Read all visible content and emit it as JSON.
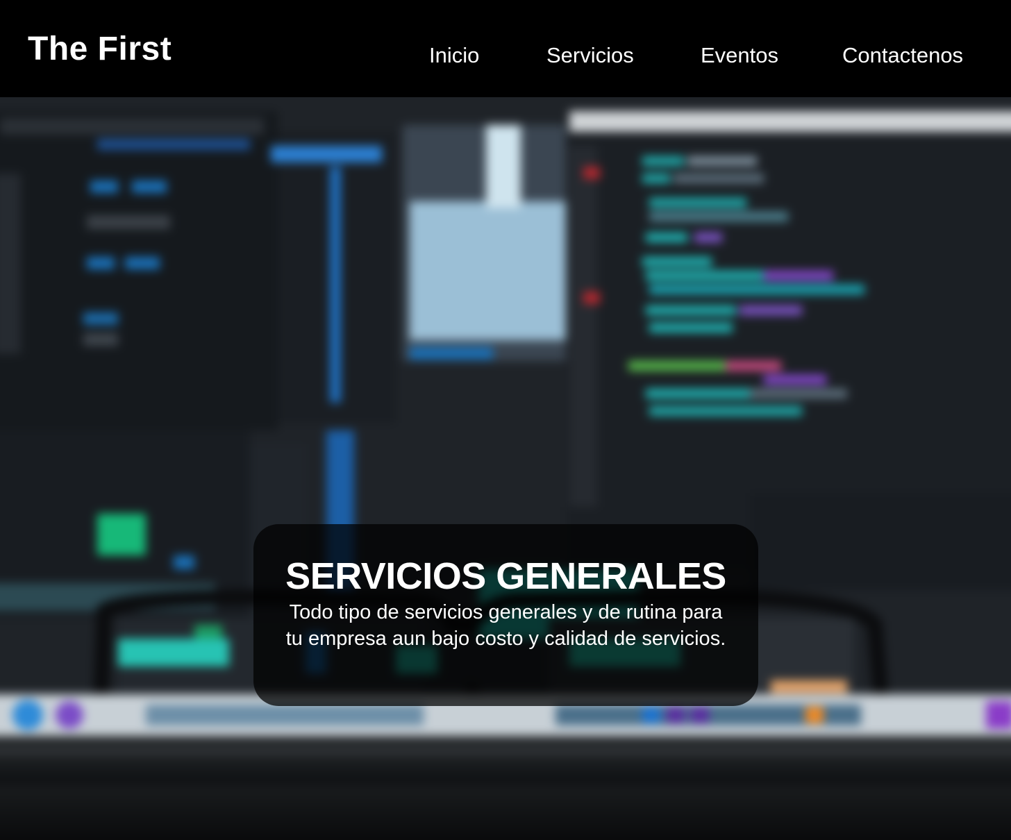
{
  "header": {
    "brand": "The First",
    "nav": {
      "inicio": "Inicio",
      "servicios": "Servicios",
      "eventos": "Eventos",
      "contactenos": "Contactenos"
    }
  },
  "hero": {
    "title": "SERVICIOS GENERALES",
    "description": "Todo tipo de servicios generales y de rutina para tu empresa aun bajo costo y calidad de servicios."
  },
  "colors": {
    "header_bg": "#000000",
    "text": "#ffffff",
    "card_bg": "rgba(0,0,0,0.72)"
  }
}
